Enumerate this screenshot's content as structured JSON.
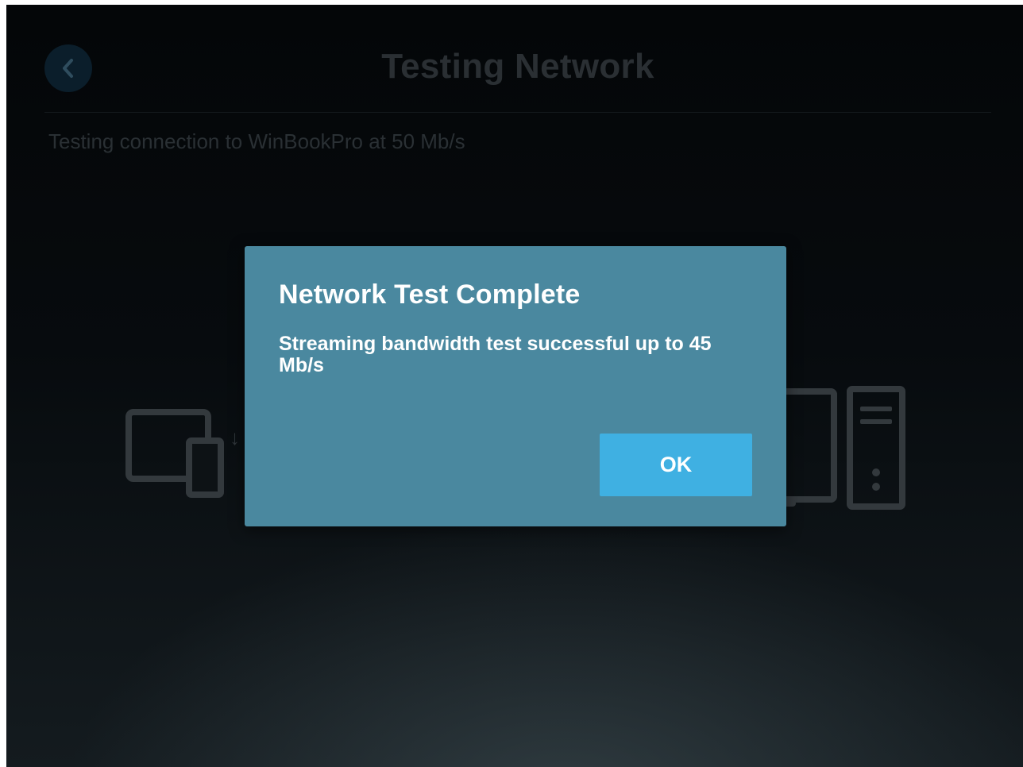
{
  "header": {
    "title": "Testing Network",
    "back_icon": "chevron-left-icon"
  },
  "status": {
    "subtitle": "Testing connection to WinBookPro at 50 Mb/s"
  },
  "background_icons": {
    "client": "tablet-phone-icon",
    "arrow": "↓",
    "host": "desktop-computer-icon"
  },
  "dialog": {
    "title": "Network Test Complete",
    "message": "Streaming bandwidth test successful up to 45 Mb/s",
    "ok_label": "OK"
  },
  "colors": {
    "dialog_background": "#4a889f",
    "button_accent": "#3fb0e2",
    "page_background": "#060a0d"
  }
}
